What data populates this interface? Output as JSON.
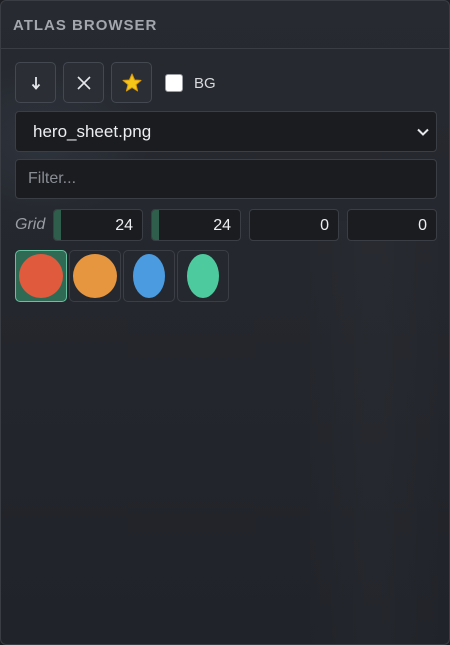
{
  "panel": {
    "title": "ATLAS BROWSER"
  },
  "toolbar": {
    "buttons": [
      {
        "name": "download-button",
        "icon": "arrow-down-icon"
      },
      {
        "name": "clear-button",
        "icon": "close-icon"
      },
      {
        "name": "favorite-button",
        "icon": "star-icon",
        "color": "#f5c518"
      }
    ],
    "bg_toggle": {
      "label": "BG",
      "checked": false
    }
  },
  "atlas_select": {
    "value": "hero_sheet.png",
    "icon": "chevron-down-icon"
  },
  "filter": {
    "placeholder": "Filter...",
    "value": ""
  },
  "grid": {
    "label": "Grid",
    "fields": [
      {
        "name": "grid-cell-width",
        "value": "24"
      },
      {
        "name": "grid-cell-height",
        "value": "24"
      },
      {
        "name": "grid-offset-x",
        "value": "0"
      },
      {
        "name": "grid-offset-y",
        "value": "0"
      }
    ]
  },
  "sprites": [
    {
      "name": "sprite-red-circle",
      "color": "#e05a3e",
      "selected": true
    },
    {
      "name": "sprite-orange-circle",
      "color": "#e5963f",
      "selected": false
    },
    {
      "name": "sprite-blue-oval",
      "color": "#4a9be0",
      "selected": false
    },
    {
      "name": "sprite-green-oval",
      "color": "#4dcb9e",
      "selected": false
    }
  ],
  "colors": {
    "accent": "#2f6a55",
    "accent_border": "#68c0a0",
    "background": "#23262c"
  }
}
